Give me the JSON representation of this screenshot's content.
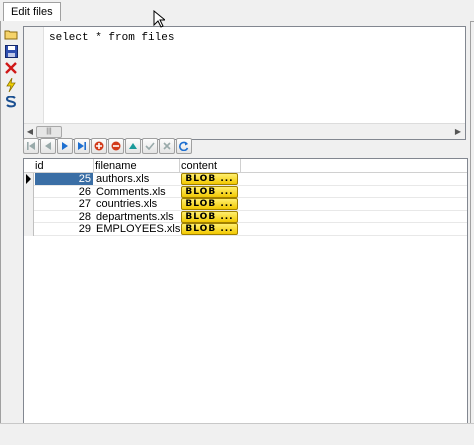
{
  "tab": {
    "label": "Edit files"
  },
  "editor": {
    "query": "select * from files"
  },
  "grid": {
    "columns": [
      "id",
      "filename",
      "content"
    ],
    "rows": [
      {
        "id": "25",
        "filename": "authors.xls",
        "content": "BLOB ..."
      },
      {
        "id": "26",
        "filename": "Comments.xls",
        "content": "BLOB ..."
      },
      {
        "id": "27",
        "filename": "countries.xls",
        "content": "BLOB ..."
      },
      {
        "id": "28",
        "filename": "departments.xls",
        "content": "BLOB ..."
      },
      {
        "id": "29",
        "filename": "EMPLOYEES.xls",
        "content": "BLOB ..."
      }
    ]
  },
  "colors": {
    "selection": "#3a6ea5",
    "blob": "#f5d000",
    "nav_blue": "#1e6fd0",
    "nav_red": "#d23a1a"
  }
}
